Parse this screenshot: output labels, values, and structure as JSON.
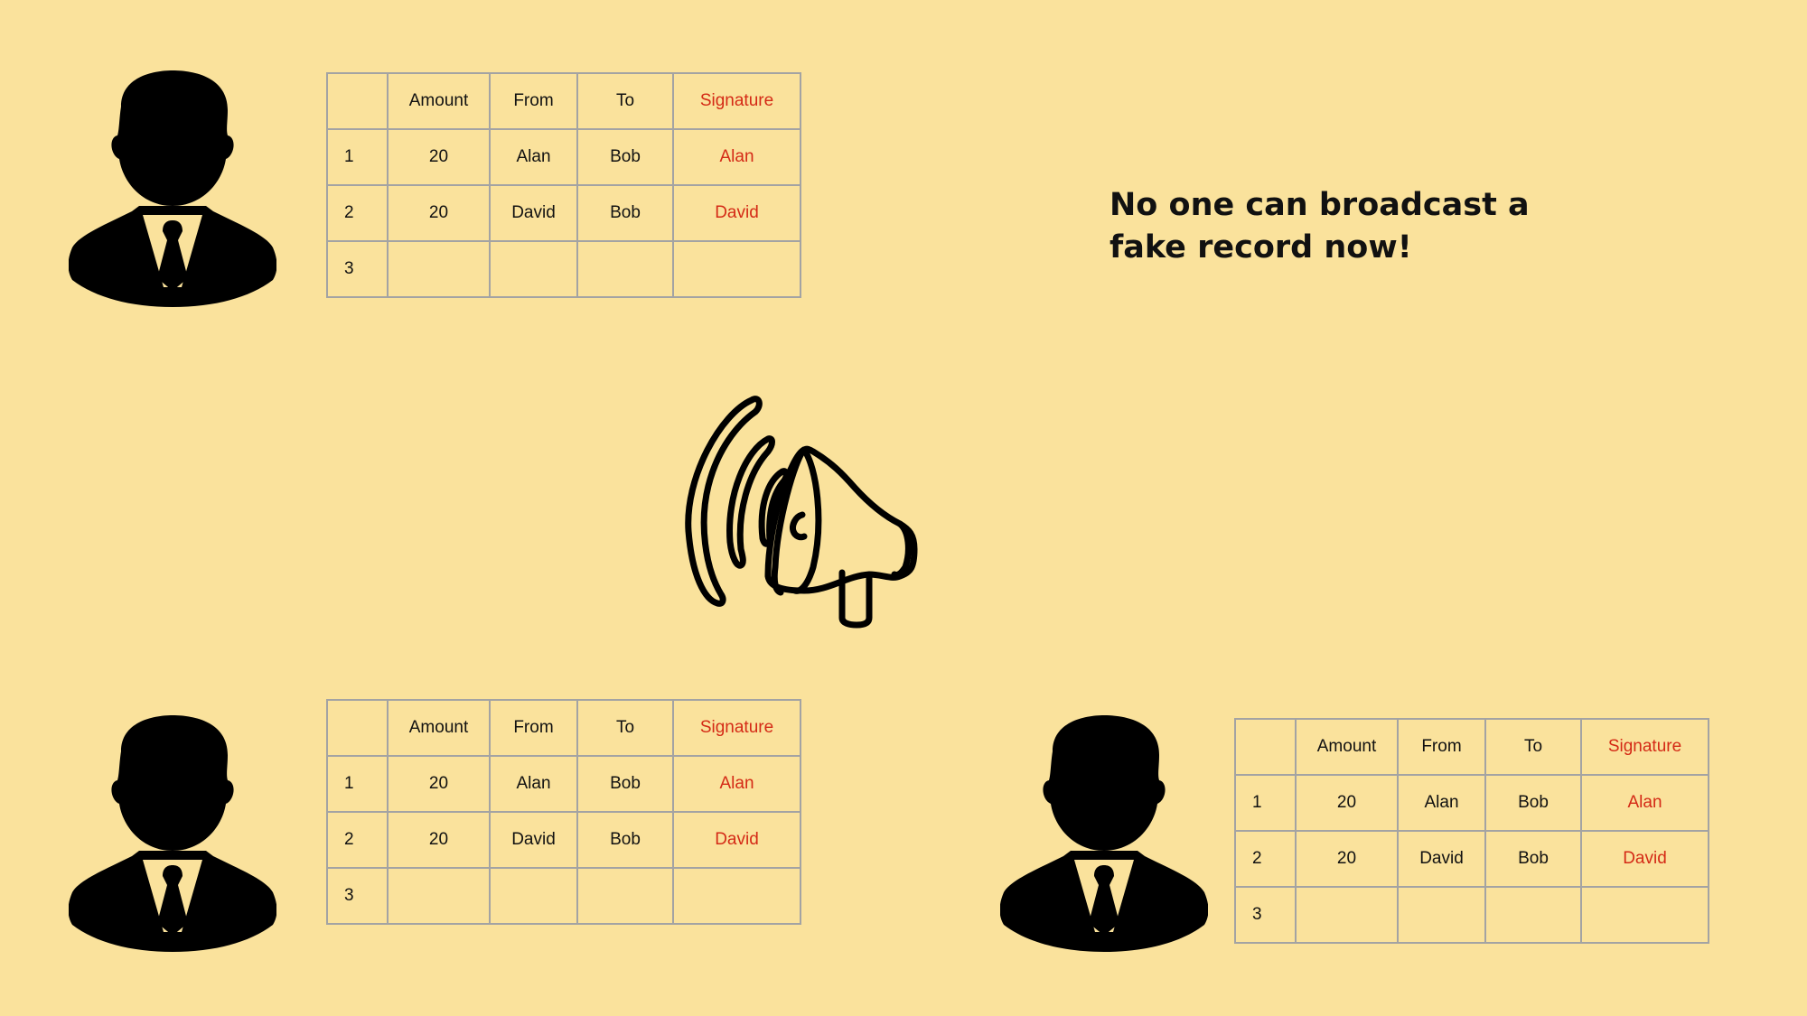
{
  "headline": "No one can broadcast a fake record now!",
  "icons": {
    "person": "person-icon",
    "megaphone": "megaphone-icon"
  },
  "colors": {
    "background": "#fae29c",
    "signature": "#d42a16",
    "grid": "#a3a3a3"
  },
  "ledgers": [
    {
      "headers": [
        "",
        "Amount",
        "From",
        "To",
        "Signature"
      ],
      "rows": [
        [
          "1",
          "20",
          "Alan",
          "Bob",
          "Alan"
        ],
        [
          "2",
          "20",
          "David",
          "Bob",
          "David"
        ],
        [
          "3",
          "",
          "",
          "",
          ""
        ]
      ]
    },
    {
      "headers": [
        "",
        "Amount",
        "From",
        "To",
        "Signature"
      ],
      "rows": [
        [
          "1",
          "20",
          "Alan",
          "Bob",
          "Alan"
        ],
        [
          "2",
          "20",
          "David",
          "Bob",
          "David"
        ],
        [
          "3",
          "",
          "",
          "",
          ""
        ]
      ]
    },
    {
      "headers": [
        "",
        "Amount",
        "From",
        "To",
        "Signature"
      ],
      "rows": [
        [
          "1",
          "20",
          "Alan",
          "Bob",
          "Alan"
        ],
        [
          "2",
          "20",
          "David",
          "Bob",
          "David"
        ],
        [
          "3",
          "",
          "",
          "",
          ""
        ]
      ]
    }
  ]
}
